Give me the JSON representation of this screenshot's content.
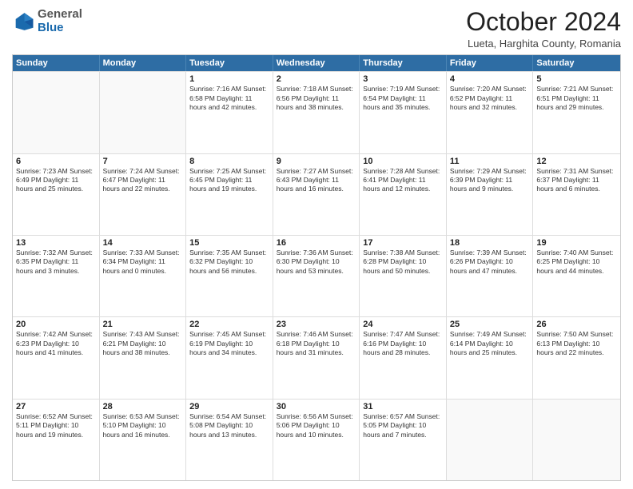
{
  "header": {
    "logo_general": "General",
    "logo_blue": "Blue",
    "month_title": "October 2024",
    "location": "Lueta, Harghita County, Romania"
  },
  "calendar": {
    "days": [
      "Sunday",
      "Monday",
      "Tuesday",
      "Wednesday",
      "Thursday",
      "Friday",
      "Saturday"
    ],
    "rows": [
      [
        {
          "day": "",
          "info": ""
        },
        {
          "day": "",
          "info": ""
        },
        {
          "day": "1",
          "info": "Sunrise: 7:16 AM\nSunset: 6:58 PM\nDaylight: 11 hours and 42 minutes."
        },
        {
          "day": "2",
          "info": "Sunrise: 7:18 AM\nSunset: 6:56 PM\nDaylight: 11 hours and 38 minutes."
        },
        {
          "day": "3",
          "info": "Sunrise: 7:19 AM\nSunset: 6:54 PM\nDaylight: 11 hours and 35 minutes."
        },
        {
          "day": "4",
          "info": "Sunrise: 7:20 AM\nSunset: 6:52 PM\nDaylight: 11 hours and 32 minutes."
        },
        {
          "day": "5",
          "info": "Sunrise: 7:21 AM\nSunset: 6:51 PM\nDaylight: 11 hours and 29 minutes."
        }
      ],
      [
        {
          "day": "6",
          "info": "Sunrise: 7:23 AM\nSunset: 6:49 PM\nDaylight: 11 hours and 25 minutes."
        },
        {
          "day": "7",
          "info": "Sunrise: 7:24 AM\nSunset: 6:47 PM\nDaylight: 11 hours and 22 minutes."
        },
        {
          "day": "8",
          "info": "Sunrise: 7:25 AM\nSunset: 6:45 PM\nDaylight: 11 hours and 19 minutes."
        },
        {
          "day": "9",
          "info": "Sunrise: 7:27 AM\nSunset: 6:43 PM\nDaylight: 11 hours and 16 minutes."
        },
        {
          "day": "10",
          "info": "Sunrise: 7:28 AM\nSunset: 6:41 PM\nDaylight: 11 hours and 12 minutes."
        },
        {
          "day": "11",
          "info": "Sunrise: 7:29 AM\nSunset: 6:39 PM\nDaylight: 11 hours and 9 minutes."
        },
        {
          "day": "12",
          "info": "Sunrise: 7:31 AM\nSunset: 6:37 PM\nDaylight: 11 hours and 6 minutes."
        }
      ],
      [
        {
          "day": "13",
          "info": "Sunrise: 7:32 AM\nSunset: 6:35 PM\nDaylight: 11 hours and 3 minutes."
        },
        {
          "day": "14",
          "info": "Sunrise: 7:33 AM\nSunset: 6:34 PM\nDaylight: 11 hours and 0 minutes."
        },
        {
          "day": "15",
          "info": "Sunrise: 7:35 AM\nSunset: 6:32 PM\nDaylight: 10 hours and 56 minutes."
        },
        {
          "day": "16",
          "info": "Sunrise: 7:36 AM\nSunset: 6:30 PM\nDaylight: 10 hours and 53 minutes."
        },
        {
          "day": "17",
          "info": "Sunrise: 7:38 AM\nSunset: 6:28 PM\nDaylight: 10 hours and 50 minutes."
        },
        {
          "day": "18",
          "info": "Sunrise: 7:39 AM\nSunset: 6:26 PM\nDaylight: 10 hours and 47 minutes."
        },
        {
          "day": "19",
          "info": "Sunrise: 7:40 AM\nSunset: 6:25 PM\nDaylight: 10 hours and 44 minutes."
        }
      ],
      [
        {
          "day": "20",
          "info": "Sunrise: 7:42 AM\nSunset: 6:23 PM\nDaylight: 10 hours and 41 minutes."
        },
        {
          "day": "21",
          "info": "Sunrise: 7:43 AM\nSunset: 6:21 PM\nDaylight: 10 hours and 38 minutes."
        },
        {
          "day": "22",
          "info": "Sunrise: 7:45 AM\nSunset: 6:19 PM\nDaylight: 10 hours and 34 minutes."
        },
        {
          "day": "23",
          "info": "Sunrise: 7:46 AM\nSunset: 6:18 PM\nDaylight: 10 hours and 31 minutes."
        },
        {
          "day": "24",
          "info": "Sunrise: 7:47 AM\nSunset: 6:16 PM\nDaylight: 10 hours and 28 minutes."
        },
        {
          "day": "25",
          "info": "Sunrise: 7:49 AM\nSunset: 6:14 PM\nDaylight: 10 hours and 25 minutes."
        },
        {
          "day": "26",
          "info": "Sunrise: 7:50 AM\nSunset: 6:13 PM\nDaylight: 10 hours and 22 minutes."
        }
      ],
      [
        {
          "day": "27",
          "info": "Sunrise: 6:52 AM\nSunset: 5:11 PM\nDaylight: 10 hours and 19 minutes."
        },
        {
          "day": "28",
          "info": "Sunrise: 6:53 AM\nSunset: 5:10 PM\nDaylight: 10 hours and 16 minutes."
        },
        {
          "day": "29",
          "info": "Sunrise: 6:54 AM\nSunset: 5:08 PM\nDaylight: 10 hours and 13 minutes."
        },
        {
          "day": "30",
          "info": "Sunrise: 6:56 AM\nSunset: 5:06 PM\nDaylight: 10 hours and 10 minutes."
        },
        {
          "day": "31",
          "info": "Sunrise: 6:57 AM\nSunset: 5:05 PM\nDaylight: 10 hours and 7 minutes."
        },
        {
          "day": "",
          "info": ""
        },
        {
          "day": "",
          "info": ""
        }
      ]
    ]
  }
}
